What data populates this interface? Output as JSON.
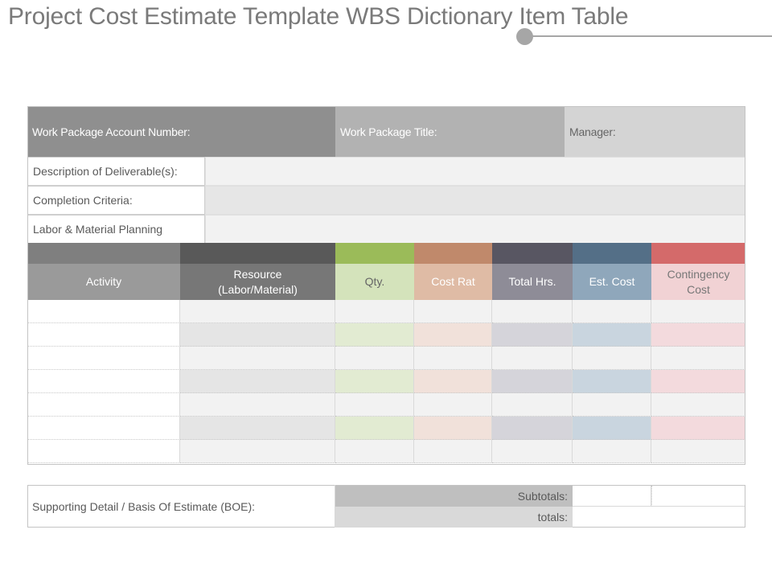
{
  "title": "Project Cost Estimate Template WBS Dictionary Item Table",
  "header": {
    "account_number_label": "Work Package Account Number:",
    "title_label": "Work Package Title:",
    "manager_label": "Manager:"
  },
  "info_rows": [
    {
      "label": "Description of Deliverable(s):"
    },
    {
      "label": "Completion Criteria:"
    },
    {
      "label": "Labor & Material Planning"
    }
  ],
  "columns": [
    {
      "label": "Activity",
      "strip_color": "#7f7f7f",
      "head_color": "#9a9a9a",
      "text_color": "#ffffff",
      "tint": "#ffffff",
      "tint_alt": "#ffffff"
    },
    {
      "label": "Resource\n(Labor/Material)",
      "strip_color": "#595959",
      "head_color": "#777777",
      "text_color": "#ffffff",
      "tint": "#f2f2f2",
      "tint_alt": "#e5e5e5"
    },
    {
      "label": "Qty.",
      "strip_color": "#9bbb59",
      "head_color": "#d4e3bb",
      "text_color": "#666666",
      "tint": "#f2f2f2",
      "tint_alt": "#e2ebd2"
    },
    {
      "label": "Cost Rat",
      "strip_color": "#c0896b",
      "head_color": "#dfbba5",
      "text_color": "#ffffff",
      "tint": "#f2f2f2",
      "tint_alt": "#f1e1da"
    },
    {
      "label": "Total Hrs.",
      "strip_color": "#585662",
      "head_color": "#8e8c97",
      "text_color": "#ffffff",
      "tint": "#f2f2f2",
      "tint_alt": "#d5d4da"
    },
    {
      "label": "Est. Cost",
      "strip_color": "#546f87",
      "head_color": "#8fa7bb",
      "text_color": "#ffffff",
      "tint": "#f2f2f2",
      "tint_alt": "#c9d5df"
    },
    {
      "label": "Contingency\nCost",
      "strip_color": "#d46a6a",
      "head_color": "#f1d2d4",
      "text_color": "#777777",
      "tint": "#f2f2f2",
      "tint_alt": "#f3dadd"
    }
  ],
  "body_rows": 7,
  "boe": {
    "label": "Supporting Detail / Basis Of Estimate (BOE):",
    "subtotals_label": "Subtotals:",
    "totals_label": "totals:"
  }
}
